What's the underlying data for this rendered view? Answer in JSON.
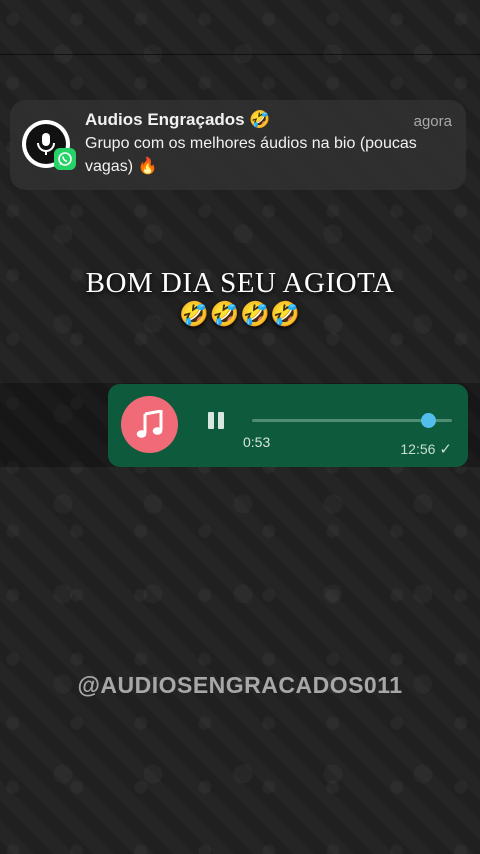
{
  "notification": {
    "title": "Audios Engraçados 🤣",
    "time": "agora",
    "message": "Grupo com os melhores áudios na bio (poucas vagas) 🔥",
    "icon": "microphone-icon",
    "badge_icon": "whatsapp-icon"
  },
  "caption": {
    "text": "BOM DIA SEU AGIOTA",
    "emojis": "🤣🤣🤣🤣"
  },
  "audio_message": {
    "avatar_icon": "music-note-icon",
    "control_icon": "pause-icon",
    "elapsed": "0:53",
    "progress": 0.88,
    "timestamp": "12:56",
    "status_icon": "✓"
  },
  "watermark": "@AUDIOSENGRACADOS011",
  "colors": {
    "bubble": "#0e5a3d",
    "avatar": "#f06a77",
    "progress_knob": "#53bdeb",
    "whatsapp_green": "#25d366"
  }
}
